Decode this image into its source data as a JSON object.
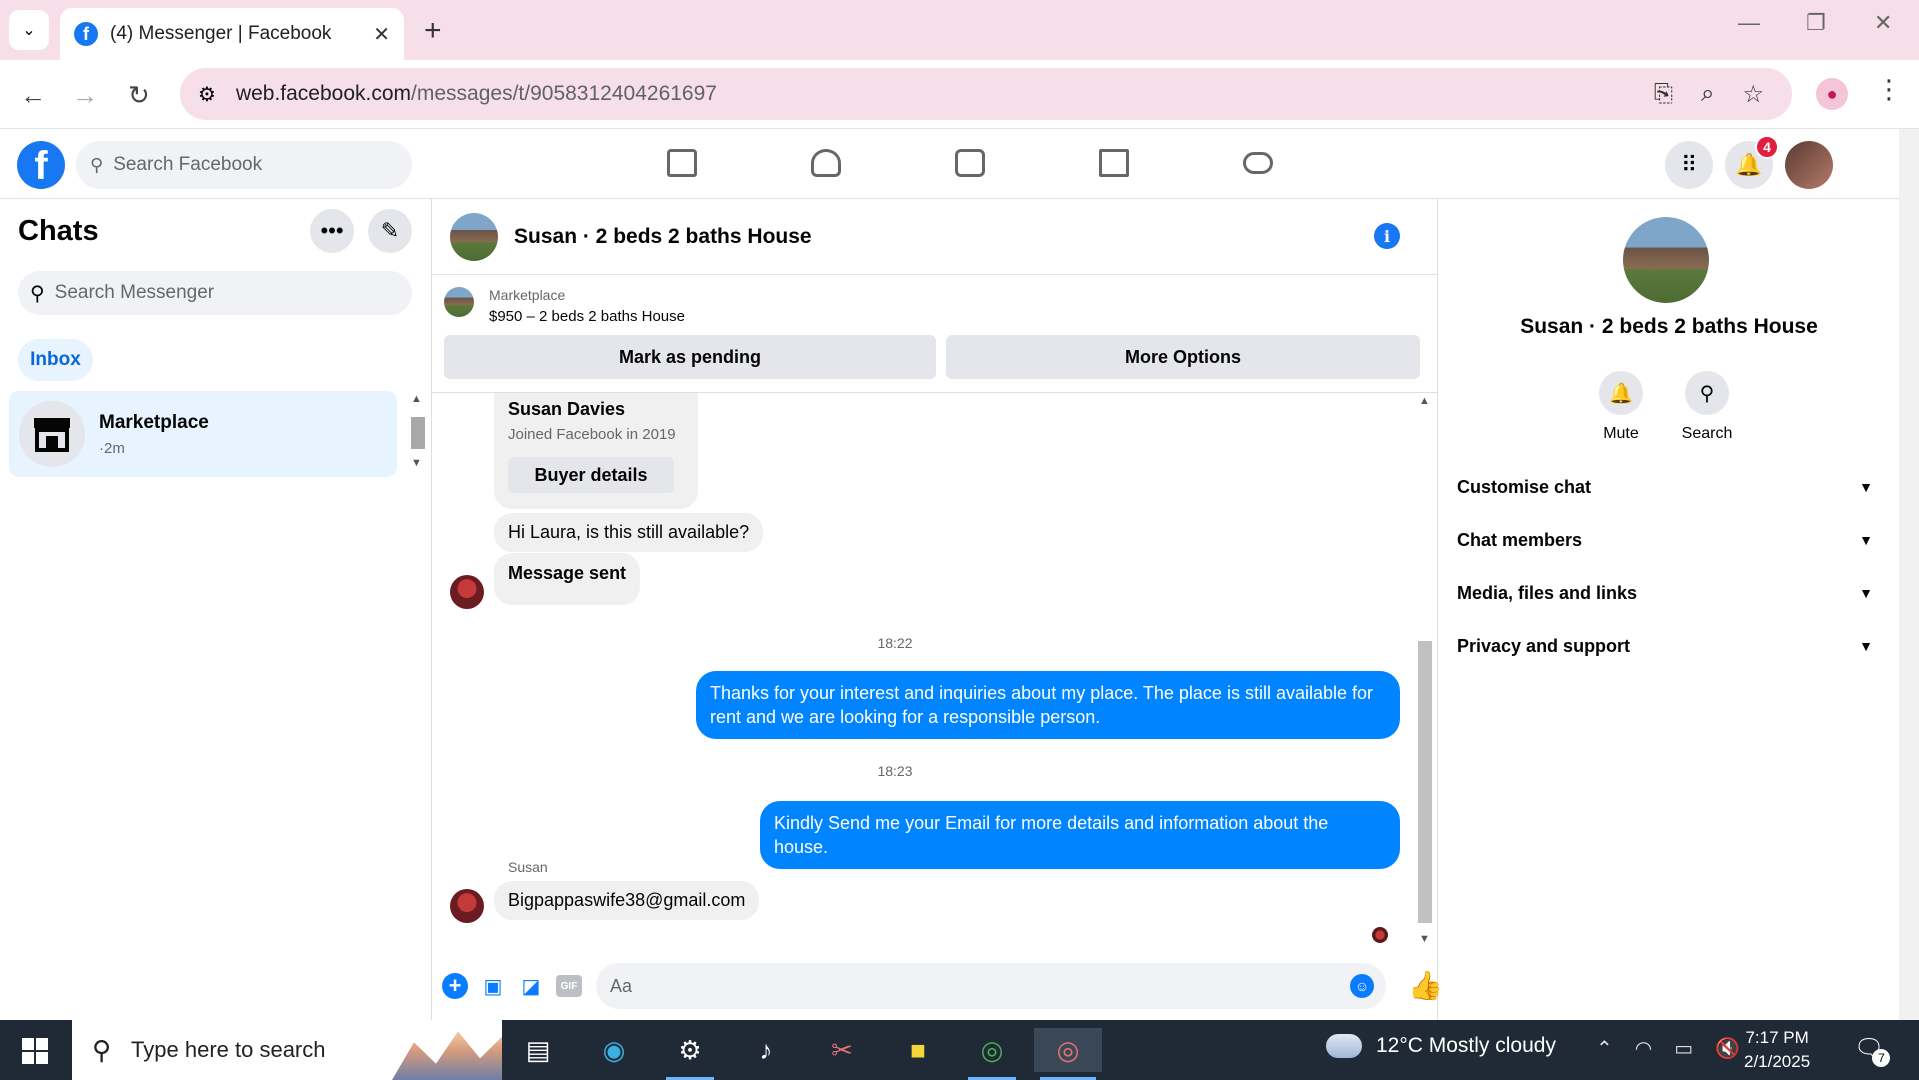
{
  "browser": {
    "tab_title": "(4) Messenger | Facebook",
    "tab_close": "✕",
    "new_tab": "+",
    "url_domain": "web.facebook.com",
    "url_path": "/messages/t/9058312404261697"
  },
  "facebook": {
    "search_placeholder": "Search Facebook",
    "notification_count": "4"
  },
  "sidebar": {
    "title": "Chats",
    "search_placeholder": "Search Messenger",
    "inbox_label": "Inbox",
    "conversations": [
      {
        "name": "Marketplace",
        "time": "·2m"
      }
    ]
  },
  "chat": {
    "title": "Susan · 2 beds 2 baths House",
    "marketplace_label": "Marketplace",
    "listing": "$950 – 2 beds 2 baths House",
    "mark_pending": "Mark as pending",
    "more_options": "More Options",
    "buyer_card": {
      "name": "Susan Davies",
      "joined": "Joined Facebook in 2019",
      "button": "Buyer details"
    },
    "messages": {
      "m1": "Hi Laura, is this still available?",
      "m2": "Message sent",
      "ts1": "18:22",
      "m3": "Thanks for your interest and inquiries about my place. The place is still available for rent and we are looking for a responsible person.",
      "ts2": "18:23",
      "m4": "Kindly Send me your Email for more details and information about the house.",
      "sender": "Susan",
      "m5": "Bigpappaswife38@gmail.com"
    },
    "composer_placeholder": "Aa",
    "gif_label": "GIF"
  },
  "info_panel": {
    "name": "Susan · 2 beds 2 baths House",
    "mute": "Mute",
    "search": "Search",
    "sections": [
      "Customise chat",
      "Chat members",
      "Media, files and links",
      "Privacy and support"
    ]
  },
  "taskbar": {
    "search_placeholder": "Type here to search",
    "weather": "12°C  Mostly cloudy",
    "time": "7:17 PM",
    "date": "2/1/2025",
    "notification_count": "7"
  },
  "colors": {
    "accent": "#0084ff",
    "fb_blue": "#1877f2",
    "browser_tint": "#f6dfe8"
  }
}
